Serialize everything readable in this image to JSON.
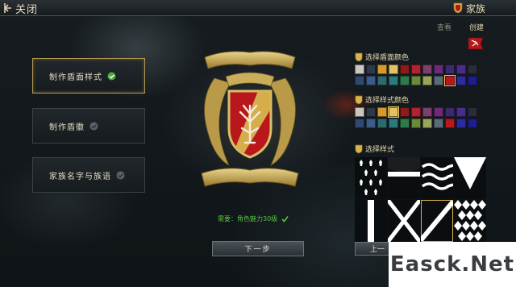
{
  "header": {
    "close_label": "关闭",
    "family_label": "家族"
  },
  "tabs": {
    "view_label": "查看",
    "create_label": "创建"
  },
  "steps": [
    {
      "label": "制作盾面样式",
      "done": true,
      "active": true
    },
    {
      "label": "制作盾徽",
      "done": false,
      "active": false
    },
    {
      "label": "家族名字与族语",
      "done": false,
      "active": false
    }
  ],
  "requirement": {
    "text": "需要：角色魅力30级",
    "met": true
  },
  "buttons": {
    "next_label": "下一步",
    "prev_label": "上一"
  },
  "shield_color_section": {
    "title": "选择盾面颜色",
    "colors": [
      "#c9c7bf",
      "#2c3a48",
      "#d79a2a",
      "#e4c062",
      "#8a1c1c",
      "#b22233",
      "#7c3e6a",
      "#6c2a7a",
      "#3a2a6e",
      "#4a2c8a",
      "#2a2c3a",
      "#2e4a70",
      "#3b5c8a",
      "#2e6a6c",
      "#2a7a80",
      "#2f7a4a",
      "#6a8a3a",
      "#9aa45a",
      "#5a6a7a",
      "#b8181c",
      "#2a2ca0",
      "#1c1e8c"
    ],
    "selected_index": 19
  },
  "pattern_color_section": {
    "title": "选择样式颜色",
    "colors": [
      "#c9c7bf",
      "#2c3a48",
      "#d79a2a",
      "#e4c062",
      "#8a1c1c",
      "#b22233",
      "#7c3e6a",
      "#6c2a7a",
      "#3a2a6e",
      "#4a2c8a",
      "#2a2c3a",
      "#2e4a70",
      "#3b5c8a",
      "#2e6a6c",
      "#2a7a80",
      "#2f7a4a",
      "#6a8a3a",
      "#9aa45a",
      "#5a6a7a",
      "#b8181c",
      "#2a2ca0",
      "#1c1e8c"
    ],
    "selected_index": 3
  },
  "style_section": {
    "title": "选择样式",
    "patterns": [
      "ermine",
      "horizontal-bar",
      "waves",
      "chevron-down",
      "pale",
      "saltire",
      "bend-sinister",
      "lozengy"
    ],
    "selected_index": 6
  },
  "watermark": "Easck.Net",
  "colors": {
    "accent_gold": "#d9b04a",
    "requirement_green": "#58c43e",
    "crest_red": "#b8181c"
  }
}
